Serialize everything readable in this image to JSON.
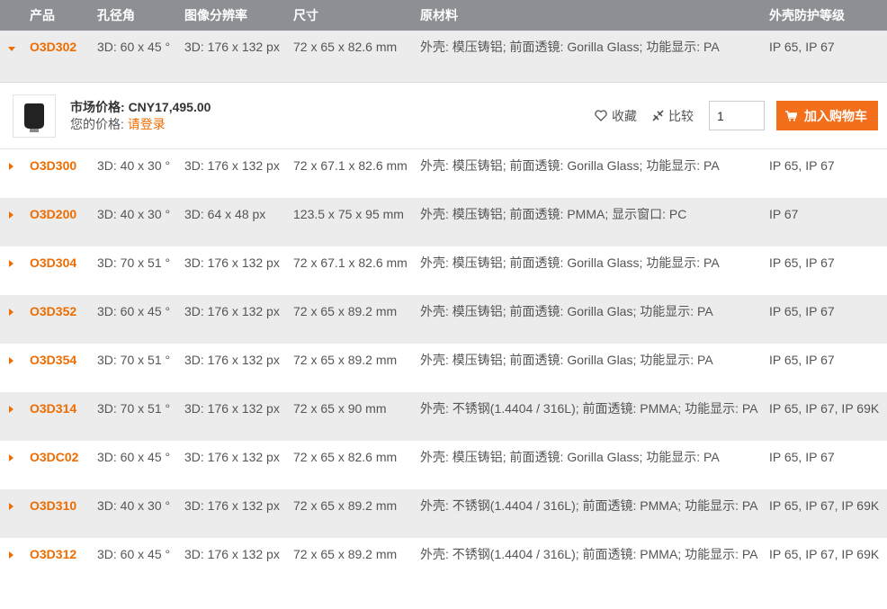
{
  "header": {
    "product": "产品",
    "aperture": "孔径角",
    "resolution": "图像分辨率",
    "size": "尺寸",
    "material": "原材料",
    "ip": "外壳防护等级"
  },
  "expanded": {
    "product": "O3D302",
    "aperture": "3D: 60 x 45 °",
    "resolution": "3D: 176 x 132 px",
    "size": "72 x 65 x 82.6 mm",
    "material": "外壳: 模压铸铝; 前面透镜: Gorilla Glass; 功能显示: PA",
    "ip": "IP 65, IP 67"
  },
  "detail": {
    "market_price_label": "市场价格:",
    "market_price_value": "CNY17,495.00",
    "your_price_label": "您的价格:",
    "login_link": "请登录",
    "favorite_label": "收藏",
    "compare_label": "比较",
    "quantity": "1",
    "add_to_cart_label": "加入购物车"
  },
  "rows": [
    {
      "product": "O3D300",
      "aperture": "3D: 40 x 30 °",
      "resolution": "3D: 176 x 132 px",
      "size": "72 x 67.1 x 82.6 mm",
      "material": "外壳: 模压铸铝; 前面透镜: Gorilla Glass; 功能显示: PA",
      "ip": "IP 65, IP 67"
    },
    {
      "product": "O3D200",
      "aperture": "3D: 40 x 30 °",
      "resolution": "3D: 64 x 48 px",
      "size": "123.5 x 75 x 95 mm",
      "material": "外壳: 模压铸铝; 前面透镜: PMMA; 显示窗口: PC",
      "ip": "IP 67"
    },
    {
      "product": "O3D304",
      "aperture": "3D: 70 x 51 °",
      "resolution": "3D: 176 x 132 px",
      "size": "72 x 67.1 x 82.6 mm",
      "material": "外壳: 模压铸铝; 前面透镜: Gorilla Glass; 功能显示: PA",
      "ip": "IP 65, IP 67"
    },
    {
      "product": "O3D352",
      "aperture": "3D: 60 x 45 °",
      "resolution": "3D: 176 x 132 px",
      "size": "72 x 65 x 89.2 mm",
      "material": "外壳: 模压铸铝; 前面透镜: Gorilla Glas; 功能显示: PA",
      "ip": "IP 65, IP 67"
    },
    {
      "product": "O3D354",
      "aperture": "3D: 70 x 51 °",
      "resolution": "3D: 176 x 132 px",
      "size": "72 x 65 x 89.2 mm",
      "material": "外壳: 模压铸铝; 前面透镜: Gorilla Glas; 功能显示: PA",
      "ip": "IP 65, IP 67"
    },
    {
      "product": "O3D314",
      "aperture": "3D: 70 x 51 °",
      "resolution": "3D: 176 x 132 px",
      "size": "72 x 65 x 90 mm",
      "material": "外壳: 不锈钢(1.4404 / 316L); 前面透镜: PMMA; 功能显示: PA",
      "ip": "IP 65, IP 67, IP 69K"
    },
    {
      "product": "O3DC02",
      "aperture": "3D: 60 x 45 °",
      "resolution": "3D: 176 x 132 px",
      "size": "72 x 65 x 82.6 mm",
      "material": "外壳: 模压铸铝; 前面透镜: Gorilla Glass; 功能显示: PA",
      "ip": "IP 65, IP 67"
    },
    {
      "product": "O3D310",
      "aperture": "3D: 40 x 30 °",
      "resolution": "3D: 176 x 132 px",
      "size": "72 x 65 x 89.2 mm",
      "material": "外壳: 不锈钢(1.4404 / 316L); 前面透镜: PMMA; 功能显示: PA",
      "ip": "IP 65, IP 67, IP 69K"
    },
    {
      "product": "O3D312",
      "aperture": "3D: 60 x 45 °",
      "resolution": "3D: 176 x 132 px",
      "size": "72 x 65 x 89.2 mm",
      "material": "外壳: 不锈钢(1.4404 / 316L); 前面透镜: PMMA; 功能显示: PA",
      "ip": "IP 65, IP 67, IP 69K"
    }
  ],
  "colors": {
    "accent": "#ef6c00",
    "header_bg": "#8c8f94",
    "row_alt": "#ececec"
  }
}
